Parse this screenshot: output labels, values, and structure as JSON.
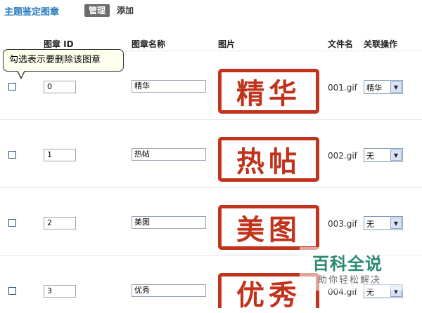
{
  "header": {
    "title": "主题鉴定图章",
    "tab_manage": "管理",
    "tab_add": "添加"
  },
  "columns": {
    "id": "图章 ID",
    "name": "图章名称",
    "image": "图片",
    "file": "文件名",
    "action": "关联操作"
  },
  "tooltip": "勾选表示要删除该图章",
  "rows": [
    {
      "id": "0",
      "name": "精华",
      "stamp_text": "精华",
      "file": "001.gif",
      "action": "精华"
    },
    {
      "id": "1",
      "name": "热帖",
      "stamp_text": "热帖",
      "file": "002.gif",
      "action": "无"
    },
    {
      "id": "2",
      "name": "美图",
      "stamp_text": "美图",
      "file": "003.gif",
      "action": "无"
    },
    {
      "id": "3",
      "name": "优秀",
      "stamp_text": "优秀",
      "file": "004.gif",
      "action": "无"
    }
  ],
  "watermark": {
    "title": "百科全说",
    "subtitle": "助你轻松解决"
  },
  "colors": {
    "accent": "#2a7bbf",
    "stamp_red": "#c2331c"
  }
}
